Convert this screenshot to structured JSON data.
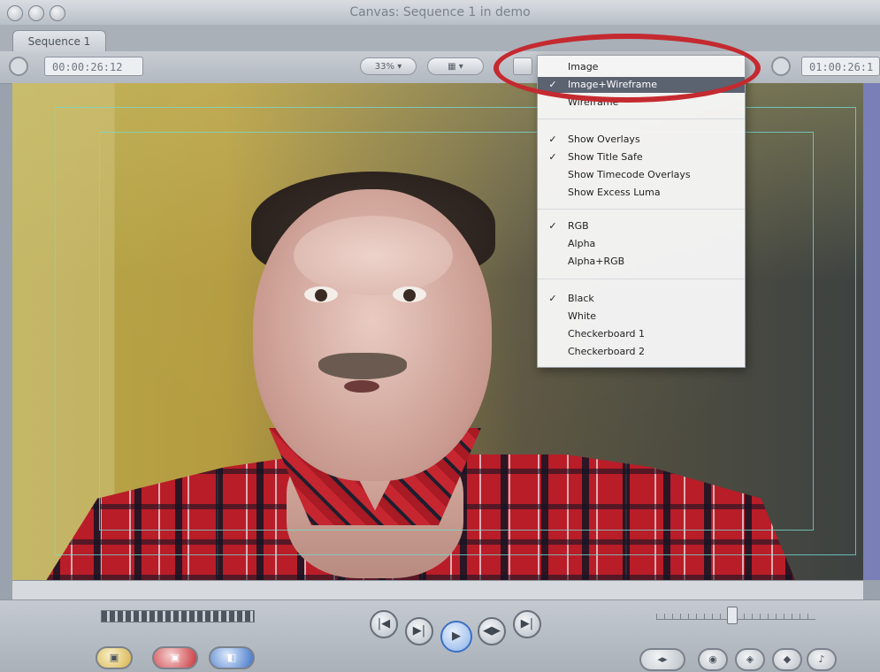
{
  "window": {
    "title": "Canvas: Sequence 1 in demo"
  },
  "tabs": [
    {
      "label": "Sequence 1"
    }
  ],
  "controls": {
    "current_timecode": "00:00:26:12",
    "duration_timecode": "01:00:26:1",
    "zoom": "33%",
    "view_menu_icon": "view-options-icon"
  },
  "view_menu": {
    "items": [
      {
        "label": "Image",
        "checked": false
      },
      {
        "label": "Image+Wireframe",
        "checked": true
      },
      {
        "label": "Wireframe",
        "checked": false
      },
      {
        "label": "Show Overlays",
        "checked": true
      },
      {
        "label": "Show Title Safe",
        "checked": true
      },
      {
        "label": "Show Timecode Overlays",
        "checked": false
      },
      {
        "label": "Show Excess Luma",
        "checked": false
      },
      {
        "label": "RGB",
        "checked": true
      },
      {
        "label": "Alpha",
        "checked": false
      },
      {
        "label": "Alpha+RGB",
        "checked": false
      },
      {
        "label": "Black",
        "checked": true
      },
      {
        "label": "White",
        "checked": false
      },
      {
        "label": "Checkerboard 1",
        "checked": false
      },
      {
        "label": "Checkerboard 2",
        "checked": false
      }
    ],
    "checkmark": "✓",
    "highlight_color": "#c42a2f"
  },
  "transport": {
    "buttons": [
      "go-to-previous-edit-icon",
      "play-in-to-out-icon",
      "play-icon",
      "play-around-current-icon",
      "go-to-next-edit-icon"
    ],
    "glyphs": [
      "|◀",
      "▶|",
      "▶",
      "◀▶",
      "▶|"
    ],
    "left_buttons": [
      "insert-edit-icon",
      "overwrite-edit-icon",
      "replace-edit-icon"
    ],
    "right_buttons": [
      "mark-in-out-icon",
      "mark-clip-icon",
      "add-marker-icon",
      "add-keyframe-icon",
      "audio-icon"
    ]
  }
}
